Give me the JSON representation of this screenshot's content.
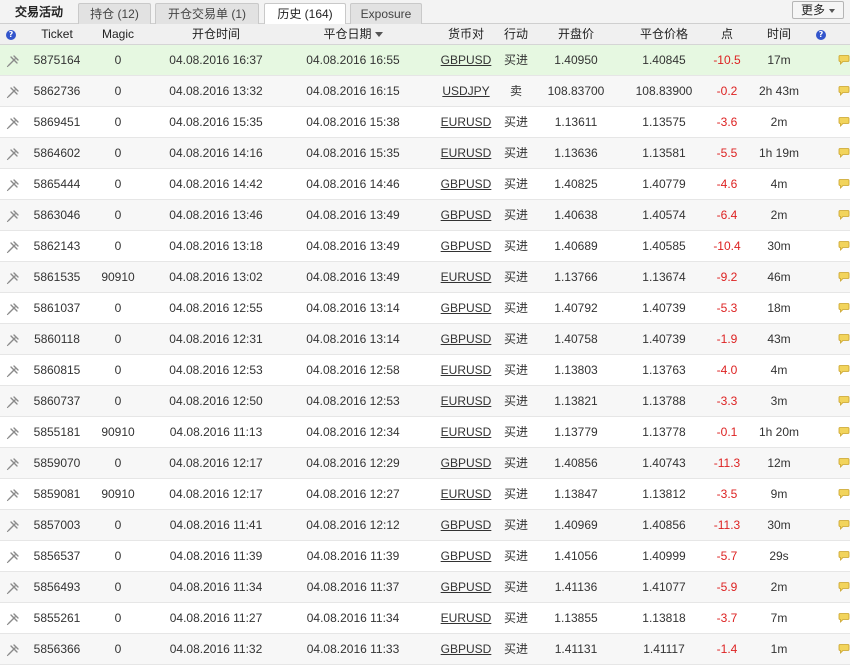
{
  "window": {
    "title": "交易活动",
    "more_label": "更多"
  },
  "tabs": [
    {
      "label": "持仓 (12)"
    },
    {
      "label": "开仓交易单 (1)"
    },
    {
      "label": "历史 (164)",
      "active": true
    },
    {
      "label": "Exposure"
    }
  ],
  "table": {
    "columns": {
      "ticket": "Ticket",
      "magic": "Magic",
      "open_time": "开仓时间",
      "close_date": "平仓日期",
      "symbol": "货币对",
      "action": "行动",
      "open_price": "开盘价",
      "close_price": "平仓价格",
      "points": "点",
      "duration": "时间"
    },
    "sort_column": "close_date",
    "rows": [
      {
        "ticket": "5875164",
        "magic": "0",
        "open_time": "04.08.2016 16:37",
        "close_date": "04.08.2016 16:55",
        "symbol": "GBPUSD",
        "action": "买进",
        "open_price": "1.40950",
        "close_price": "1.40845",
        "points": "-10.5",
        "duration": "17m"
      },
      {
        "ticket": "5862736",
        "magic": "0",
        "open_time": "04.08.2016 13:32",
        "close_date": "04.08.2016 16:15",
        "symbol": "USDJPY",
        "action": "卖",
        "open_price": "108.83700",
        "close_price": "108.83900",
        "points": "-0.2",
        "duration": "2h 43m"
      },
      {
        "ticket": "5869451",
        "magic": "0",
        "open_time": "04.08.2016 15:35",
        "close_date": "04.08.2016 15:38",
        "symbol": "EURUSD",
        "action": "买进",
        "open_price": "1.13611",
        "close_price": "1.13575",
        "points": "-3.6",
        "duration": "2m"
      },
      {
        "ticket": "5864602",
        "magic": "0",
        "open_time": "04.08.2016 14:16",
        "close_date": "04.08.2016 15:35",
        "symbol": "EURUSD",
        "action": "买进",
        "open_price": "1.13636",
        "close_price": "1.13581",
        "points": "-5.5",
        "duration": "1h 19m"
      },
      {
        "ticket": "5865444",
        "magic": "0",
        "open_time": "04.08.2016 14:42",
        "close_date": "04.08.2016 14:46",
        "symbol": "GBPUSD",
        "action": "买进",
        "open_price": "1.40825",
        "close_price": "1.40779",
        "points": "-4.6",
        "duration": "4m"
      },
      {
        "ticket": "5863046",
        "magic": "0",
        "open_time": "04.08.2016 13:46",
        "close_date": "04.08.2016 13:49",
        "symbol": "GBPUSD",
        "action": "买进",
        "open_price": "1.40638",
        "close_price": "1.40574",
        "points": "-6.4",
        "duration": "2m"
      },
      {
        "ticket": "5862143",
        "magic": "0",
        "open_time": "04.08.2016 13:18",
        "close_date": "04.08.2016 13:49",
        "symbol": "GBPUSD",
        "action": "买进",
        "open_price": "1.40689",
        "close_price": "1.40585",
        "points": "-10.4",
        "duration": "30m"
      },
      {
        "ticket": "5861535",
        "magic": "90910",
        "open_time": "04.08.2016 13:02",
        "close_date": "04.08.2016 13:49",
        "symbol": "EURUSD",
        "action": "买进",
        "open_price": "1.13766",
        "close_price": "1.13674",
        "points": "-9.2",
        "duration": "46m"
      },
      {
        "ticket": "5861037",
        "magic": "0",
        "open_time": "04.08.2016 12:55",
        "close_date": "04.08.2016 13:14",
        "symbol": "GBPUSD",
        "action": "买进",
        "open_price": "1.40792",
        "close_price": "1.40739",
        "points": "-5.3",
        "duration": "18m"
      },
      {
        "ticket": "5860118",
        "magic": "0",
        "open_time": "04.08.2016 12:31",
        "close_date": "04.08.2016 13:14",
        "symbol": "GBPUSD",
        "action": "买进",
        "open_price": "1.40758",
        "close_price": "1.40739",
        "points": "-1.9",
        "duration": "43m"
      },
      {
        "ticket": "5860815",
        "magic": "0",
        "open_time": "04.08.2016 12:53",
        "close_date": "04.08.2016 12:58",
        "symbol": "EURUSD",
        "action": "买进",
        "open_price": "1.13803",
        "close_price": "1.13763",
        "points": "-4.0",
        "duration": "4m"
      },
      {
        "ticket": "5860737",
        "magic": "0",
        "open_time": "04.08.2016 12:50",
        "close_date": "04.08.2016 12:53",
        "symbol": "EURUSD",
        "action": "买进",
        "open_price": "1.13821",
        "close_price": "1.13788",
        "points": "-3.3",
        "duration": "3m"
      },
      {
        "ticket": "5855181",
        "magic": "90910",
        "open_time": "04.08.2016 11:13",
        "close_date": "04.08.2016 12:34",
        "symbol": "EURUSD",
        "action": "买进",
        "open_price": "1.13779",
        "close_price": "1.13778",
        "points": "-0.1",
        "duration": "1h 20m"
      },
      {
        "ticket": "5859070",
        "magic": "0",
        "open_time": "04.08.2016 12:17",
        "close_date": "04.08.2016 12:29",
        "symbol": "GBPUSD",
        "action": "买进",
        "open_price": "1.40856",
        "close_price": "1.40743",
        "points": "-11.3",
        "duration": "12m"
      },
      {
        "ticket": "5859081",
        "magic": "90910",
        "open_time": "04.08.2016 12:17",
        "close_date": "04.08.2016 12:27",
        "symbol": "EURUSD",
        "action": "买进",
        "open_price": "1.13847",
        "close_price": "1.13812",
        "points": "-3.5",
        "duration": "9m"
      },
      {
        "ticket": "5857003",
        "magic": "0",
        "open_time": "04.08.2016 11:41",
        "close_date": "04.08.2016 12:12",
        "symbol": "GBPUSD",
        "action": "买进",
        "open_price": "1.40969",
        "close_price": "1.40856",
        "points": "-11.3",
        "duration": "30m"
      },
      {
        "ticket": "5856537",
        "magic": "0",
        "open_time": "04.08.2016 11:39",
        "close_date": "04.08.2016 11:39",
        "symbol": "GBPUSD",
        "action": "买进",
        "open_price": "1.41056",
        "close_price": "1.40999",
        "points": "-5.7",
        "duration": "29s"
      },
      {
        "ticket": "5856493",
        "magic": "0",
        "open_time": "04.08.2016 11:34",
        "close_date": "04.08.2016 11:37",
        "symbol": "GBPUSD",
        "action": "买进",
        "open_price": "1.41136",
        "close_price": "1.41077",
        "points": "-5.9",
        "duration": "2m"
      },
      {
        "ticket": "5855261",
        "magic": "0",
        "open_time": "04.08.2016 11:27",
        "close_date": "04.08.2016 11:34",
        "symbol": "EURUSD",
        "action": "买进",
        "open_price": "1.13855",
        "close_price": "1.13818",
        "points": "-3.7",
        "duration": "7m"
      },
      {
        "ticket": "5856366",
        "magic": "0",
        "open_time": "04.08.2016 11:32",
        "close_date": "04.08.2016 11:33",
        "symbol": "GBPUSD",
        "action": "买进",
        "open_price": "1.41131",
        "close_price": "1.41117",
        "points": "-1.4",
        "duration": "1m"
      }
    ]
  },
  "colors": {
    "negative_points": "#dd2222",
    "selected_row": "#e6f8e1",
    "help_icon": "#3355cc"
  }
}
